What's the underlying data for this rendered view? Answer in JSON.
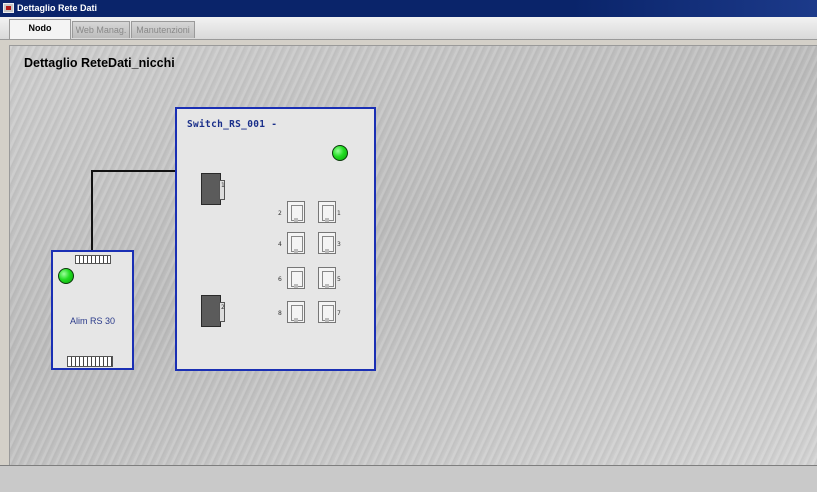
{
  "window": {
    "title": "Dettaglio Rete Dati"
  },
  "tabs": [
    {
      "label": "Nodo",
      "active": true
    },
    {
      "label": "Web Manag.",
      "active": false
    },
    {
      "label": "Manutenzioni",
      "active": false
    }
  ],
  "page": {
    "title": "Dettaglio ReteDati_nicchi"
  },
  "switch": {
    "name": "Switch_RS_001 -",
    "status": "online",
    "uplink_ports": [
      "1",
      "2"
    ],
    "rj45_ports": [
      "1",
      "2",
      "3",
      "4",
      "5",
      "6",
      "7",
      "8"
    ]
  },
  "power_supply": {
    "label": "Alim RS 30",
    "status": "online"
  },
  "colors": {
    "device_border": "#1a2fb4",
    "led_ok": "#22dd22",
    "title_bar": "#0a246a"
  }
}
